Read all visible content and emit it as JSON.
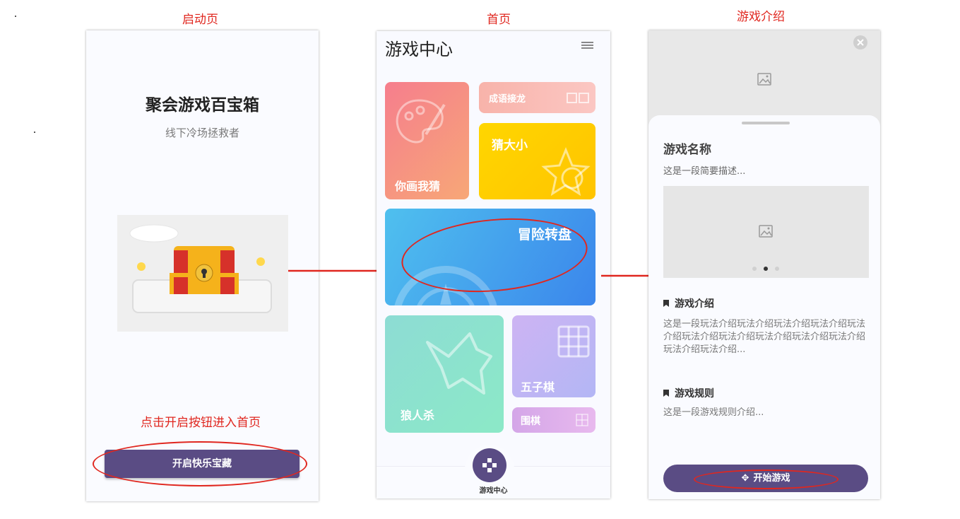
{
  "captions": {
    "splash": "启动页",
    "home": "首页",
    "detail": "游戏介绍",
    "note": "点击开启按钮进入首页"
  },
  "splash": {
    "title": "聚会游戏百宝箱",
    "subtitle": "线下冷场拯救者",
    "image_icon": "treasure-chest-illustration",
    "button_label": "开启快乐宝藏"
  },
  "home": {
    "title": "游戏中心",
    "menu_icon": "hamburger-menu-icon",
    "cards": {
      "draw": "你画我猜",
      "idiom": "成语接龙",
      "guess": "猜大小",
      "spin": "冒险转盘",
      "wolf": "狼人杀",
      "gomoku": "五子棋",
      "go": "围棋"
    },
    "tab_label": "游戏中心"
  },
  "detail": {
    "close_icon": "close-icon",
    "name": "游戏名称",
    "desc": "这是一段简要描述...",
    "intro_title": "游戏介绍",
    "intro_body": "这是一段玩法介绍玩法介绍玩法介绍玩法介绍玩法介绍玩法介绍玩法介绍玩法介绍玩法介绍玩法介绍玩法介绍玩法介绍...",
    "rules_title": "游戏规则",
    "rules_body": "这是一段游戏规则介绍...",
    "start_label": "开始游戏"
  },
  "colors": {
    "accent": "#5a4c84",
    "annotation_red": "#e0271f"
  }
}
